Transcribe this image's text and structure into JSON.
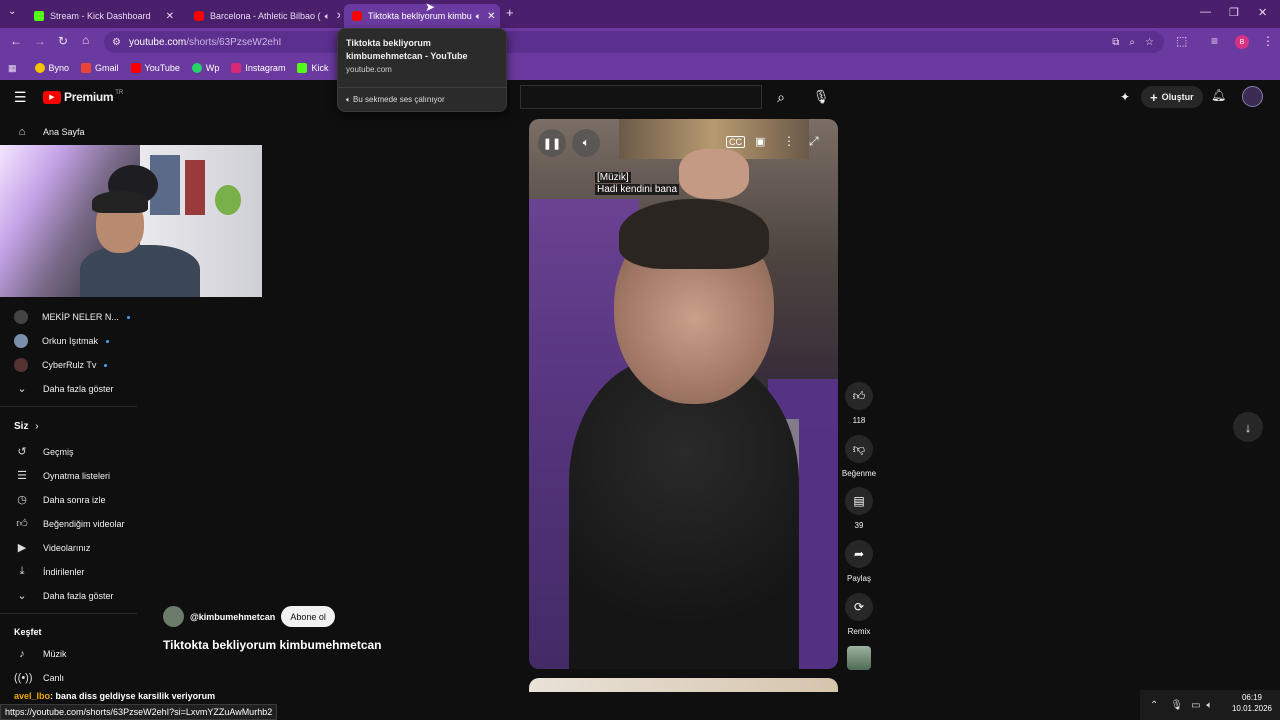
{
  "browser": {
    "tabs": [
      {
        "label": "Stream - Kick Dashboard",
        "favicon_color": "#53fc18"
      },
      {
        "label": "Barcelona - Athletic Bilbao (",
        "favicon_color": "#ff0000"
      },
      {
        "label": "Tiktokta bekliyorum kimbu",
        "favicon_color": "#ff0000"
      }
    ],
    "new_tab": "+",
    "window_controls": {
      "minimize": "—",
      "restore": "❐",
      "close": "✕"
    },
    "address": {
      "domain": "youtube.com",
      "path": "/shorts/63PzseW2ehI"
    },
    "bookmarks": [
      {
        "label": "Byno",
        "color": "#f5c400"
      },
      {
        "label": "Gmail",
        "color": "#ea4335"
      },
      {
        "label": "YouTube",
        "color": "#ff0000"
      },
      {
        "label": "Wp",
        "color": "#25d366"
      },
      {
        "label": "Instagram",
        "color": "#d62976"
      },
      {
        "label": "Kick",
        "color": "#53fc18"
      }
    ],
    "profile_initial": "B"
  },
  "tooltip": {
    "title": "Tiktokta bekliyorum kimbumehmetcan - YouTube",
    "domain": "youtube.com",
    "audio": "Bu sekmede ses çalınıyor"
  },
  "yt": {
    "logo": "Premium",
    "region": "TR",
    "create_label": "Oluştur",
    "sidebar": {
      "home": "Ana Sayfa",
      "subscriptions": [
        {
          "label": "MEKİP NELER N...",
          "avatar_color": "#444"
        },
        {
          "label": "Orkun Işıtmak",
          "avatar_color": "#7a8fa8"
        },
        {
          "label": "CyberRulz Tv",
          "avatar_color": "#553333"
        }
      ],
      "show_more_1": "Daha fazla göster",
      "you_heading": "Siz",
      "you_items": [
        {
          "label": "Geçmiş",
          "icon": "history-icon"
        },
        {
          "label": "Oynatma listeleri",
          "icon": "playlist-icon"
        },
        {
          "label": "Daha sonra izle",
          "icon": "watch-later-icon"
        },
        {
          "label": "Beğendiğim videolar",
          "icon": "like-icon"
        },
        {
          "label": "Videolarınız",
          "icon": "your-videos-icon"
        },
        {
          "label": "İndirilenler",
          "icon": "download-icon"
        }
      ],
      "show_more_2": "Daha fazla göster",
      "explore_heading": "Keşfet",
      "explore_items": [
        {
          "label": "Müzik",
          "icon": "music-icon"
        },
        {
          "label": "Canlı",
          "icon": "live-icon"
        }
      ]
    },
    "player": {
      "caption_line1": "[Müzik]",
      "caption_line2": "Hadi kendini bana"
    },
    "actions": {
      "likes": "118",
      "dislike_label": "Beğenme",
      "comments": "39",
      "share_label": "Paylaş",
      "remix_label": "Remix"
    },
    "channel": "@kimbumehmetcan",
    "subscribe": "Abone ol",
    "video_title": "Tiktokta bekliyorum kimbumehmetcan"
  },
  "overlay": {
    "chat_user": "avel_lbo",
    "chat_message": ": bana diss geldiyse karsilik veriyorum",
    "status_url": "https://youtube.com/shorts/63PzseW2ehI?si=LxvmYZZuAwMurhb2"
  },
  "taskbar": {
    "time": "06:19",
    "date": "10.01.2026"
  }
}
